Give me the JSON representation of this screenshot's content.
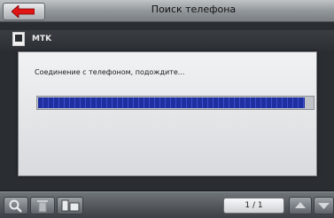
{
  "header": {
    "title": "Поиск телефона"
  },
  "list": {
    "items": [
      {
        "label": "MTK"
      }
    ]
  },
  "modal": {
    "message": "Соединение с телефоном, подождите...",
    "progress": 0.97
  },
  "toolbar": {
    "page_indicator": "1 / 1",
    "icons": [
      "search-icon",
      "trash-icon",
      "phone-transfer-icon",
      "scroll-up-icon",
      "scroll-down-icon"
    ]
  },
  "colors": {
    "accent_red": "#e01515",
    "progress_blue": "#1f2fa0"
  }
}
